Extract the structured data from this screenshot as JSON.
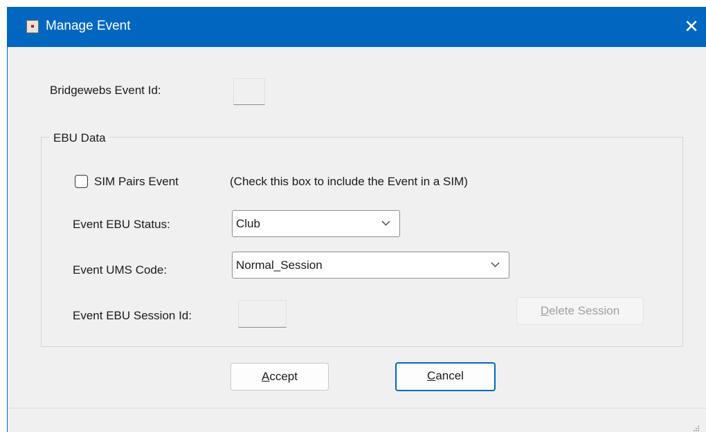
{
  "window": {
    "title": "Manage Event",
    "close_glyph": "✕",
    "icon": "app-icon"
  },
  "bridgewebs": {
    "label": "Bridgewebs Event Id:",
    "value": ""
  },
  "ebu": {
    "group_label": "EBU Data",
    "sim_pairs_label": "SIM Pairs Event",
    "sim_pairs_checked": false,
    "sim_pairs_hint": "(Check this box to include the Event in a SIM)",
    "status_label": "Event EBU Status:",
    "status_value": "Club",
    "ums_label": "Event UMS Code:",
    "ums_value": "Normal_Session",
    "session_label": "Event EBU Session Id:",
    "session_value": "",
    "delete_session_label": "Delete Session",
    "delete_session_mnemonic": "D",
    "delete_session_rest": "elete Session"
  },
  "buttons": {
    "accept_mnemonic": "A",
    "accept_rest": "ccept",
    "cancel_mnemonic": "C",
    "cancel_rest": "ancel"
  },
  "colors": {
    "titlebar": "#0067c0",
    "dialog_bg": "#f0f0f0",
    "default_button_border": "#0067c0"
  }
}
